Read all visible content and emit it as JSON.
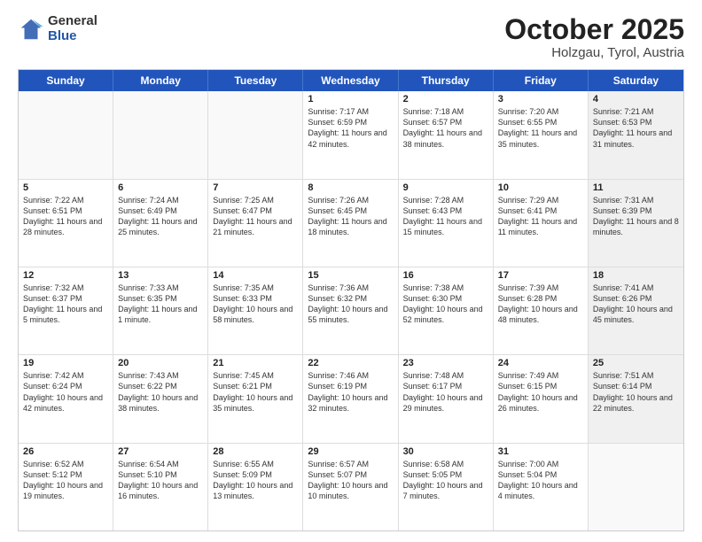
{
  "header": {
    "logo_general": "General",
    "logo_blue": "Blue",
    "month": "October 2025",
    "location": "Holzgau, Tyrol, Austria"
  },
  "days": [
    "Sunday",
    "Monday",
    "Tuesday",
    "Wednesday",
    "Thursday",
    "Friday",
    "Saturday"
  ],
  "rows": [
    [
      {
        "day": "",
        "empty": true
      },
      {
        "day": "",
        "empty": true
      },
      {
        "day": "",
        "empty": true
      },
      {
        "day": "1",
        "sunrise": "Sunrise: 7:17 AM",
        "sunset": "Sunset: 6:59 PM",
        "daylight": "Daylight: 11 hours and 42 minutes."
      },
      {
        "day": "2",
        "sunrise": "Sunrise: 7:18 AM",
        "sunset": "Sunset: 6:57 PM",
        "daylight": "Daylight: 11 hours and 38 minutes."
      },
      {
        "day": "3",
        "sunrise": "Sunrise: 7:20 AM",
        "sunset": "Sunset: 6:55 PM",
        "daylight": "Daylight: 11 hours and 35 minutes."
      },
      {
        "day": "4",
        "sunrise": "Sunrise: 7:21 AM",
        "sunset": "Sunset: 6:53 PM",
        "daylight": "Daylight: 11 hours and 31 minutes.",
        "shaded": true
      }
    ],
    [
      {
        "day": "5",
        "sunrise": "Sunrise: 7:22 AM",
        "sunset": "Sunset: 6:51 PM",
        "daylight": "Daylight: 11 hours and 28 minutes."
      },
      {
        "day": "6",
        "sunrise": "Sunrise: 7:24 AM",
        "sunset": "Sunset: 6:49 PM",
        "daylight": "Daylight: 11 hours and 25 minutes."
      },
      {
        "day": "7",
        "sunrise": "Sunrise: 7:25 AM",
        "sunset": "Sunset: 6:47 PM",
        "daylight": "Daylight: 11 hours and 21 minutes."
      },
      {
        "day": "8",
        "sunrise": "Sunrise: 7:26 AM",
        "sunset": "Sunset: 6:45 PM",
        "daylight": "Daylight: 11 hours and 18 minutes."
      },
      {
        "day": "9",
        "sunrise": "Sunrise: 7:28 AM",
        "sunset": "Sunset: 6:43 PM",
        "daylight": "Daylight: 11 hours and 15 minutes."
      },
      {
        "day": "10",
        "sunrise": "Sunrise: 7:29 AM",
        "sunset": "Sunset: 6:41 PM",
        "daylight": "Daylight: 11 hours and 11 minutes."
      },
      {
        "day": "11",
        "sunrise": "Sunrise: 7:31 AM",
        "sunset": "Sunset: 6:39 PM",
        "daylight": "Daylight: 11 hours and 8 minutes.",
        "shaded": true
      }
    ],
    [
      {
        "day": "12",
        "sunrise": "Sunrise: 7:32 AM",
        "sunset": "Sunset: 6:37 PM",
        "daylight": "Daylight: 11 hours and 5 minutes."
      },
      {
        "day": "13",
        "sunrise": "Sunrise: 7:33 AM",
        "sunset": "Sunset: 6:35 PM",
        "daylight": "Daylight: 11 hours and 1 minute."
      },
      {
        "day": "14",
        "sunrise": "Sunrise: 7:35 AM",
        "sunset": "Sunset: 6:33 PM",
        "daylight": "Daylight: 10 hours and 58 minutes."
      },
      {
        "day": "15",
        "sunrise": "Sunrise: 7:36 AM",
        "sunset": "Sunset: 6:32 PM",
        "daylight": "Daylight: 10 hours and 55 minutes."
      },
      {
        "day": "16",
        "sunrise": "Sunrise: 7:38 AM",
        "sunset": "Sunset: 6:30 PM",
        "daylight": "Daylight: 10 hours and 52 minutes."
      },
      {
        "day": "17",
        "sunrise": "Sunrise: 7:39 AM",
        "sunset": "Sunset: 6:28 PM",
        "daylight": "Daylight: 10 hours and 48 minutes."
      },
      {
        "day": "18",
        "sunrise": "Sunrise: 7:41 AM",
        "sunset": "Sunset: 6:26 PM",
        "daylight": "Daylight: 10 hours and 45 minutes.",
        "shaded": true
      }
    ],
    [
      {
        "day": "19",
        "sunrise": "Sunrise: 7:42 AM",
        "sunset": "Sunset: 6:24 PM",
        "daylight": "Daylight: 10 hours and 42 minutes."
      },
      {
        "day": "20",
        "sunrise": "Sunrise: 7:43 AM",
        "sunset": "Sunset: 6:22 PM",
        "daylight": "Daylight: 10 hours and 38 minutes."
      },
      {
        "day": "21",
        "sunrise": "Sunrise: 7:45 AM",
        "sunset": "Sunset: 6:21 PM",
        "daylight": "Daylight: 10 hours and 35 minutes."
      },
      {
        "day": "22",
        "sunrise": "Sunrise: 7:46 AM",
        "sunset": "Sunset: 6:19 PM",
        "daylight": "Daylight: 10 hours and 32 minutes."
      },
      {
        "day": "23",
        "sunrise": "Sunrise: 7:48 AM",
        "sunset": "Sunset: 6:17 PM",
        "daylight": "Daylight: 10 hours and 29 minutes."
      },
      {
        "day": "24",
        "sunrise": "Sunrise: 7:49 AM",
        "sunset": "Sunset: 6:15 PM",
        "daylight": "Daylight: 10 hours and 26 minutes."
      },
      {
        "day": "25",
        "sunrise": "Sunrise: 7:51 AM",
        "sunset": "Sunset: 6:14 PM",
        "daylight": "Daylight: 10 hours and 22 minutes.",
        "shaded": true
      }
    ],
    [
      {
        "day": "26",
        "sunrise": "Sunrise: 6:52 AM",
        "sunset": "Sunset: 5:12 PM",
        "daylight": "Daylight: 10 hours and 19 minutes."
      },
      {
        "day": "27",
        "sunrise": "Sunrise: 6:54 AM",
        "sunset": "Sunset: 5:10 PM",
        "daylight": "Daylight: 10 hours and 16 minutes."
      },
      {
        "day": "28",
        "sunrise": "Sunrise: 6:55 AM",
        "sunset": "Sunset: 5:09 PM",
        "daylight": "Daylight: 10 hours and 13 minutes."
      },
      {
        "day": "29",
        "sunrise": "Sunrise: 6:57 AM",
        "sunset": "Sunset: 5:07 PM",
        "daylight": "Daylight: 10 hours and 10 minutes."
      },
      {
        "day": "30",
        "sunrise": "Sunrise: 6:58 AM",
        "sunset": "Sunset: 5:05 PM",
        "daylight": "Daylight: 10 hours and 7 minutes."
      },
      {
        "day": "31",
        "sunrise": "Sunrise: 7:00 AM",
        "sunset": "Sunset: 5:04 PM",
        "daylight": "Daylight: 10 hours and 4 minutes."
      },
      {
        "day": "",
        "empty": true,
        "shaded": true
      }
    ]
  ]
}
